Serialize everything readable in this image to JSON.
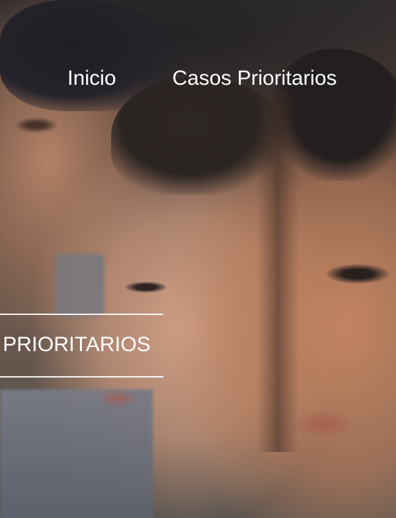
{
  "nav": {
    "items": [
      {
        "label": "Inicio"
      },
      {
        "label": "Casos Prioritarios"
      }
    ]
  },
  "hero": {
    "section_title": "PRIORITARIOS"
  }
}
